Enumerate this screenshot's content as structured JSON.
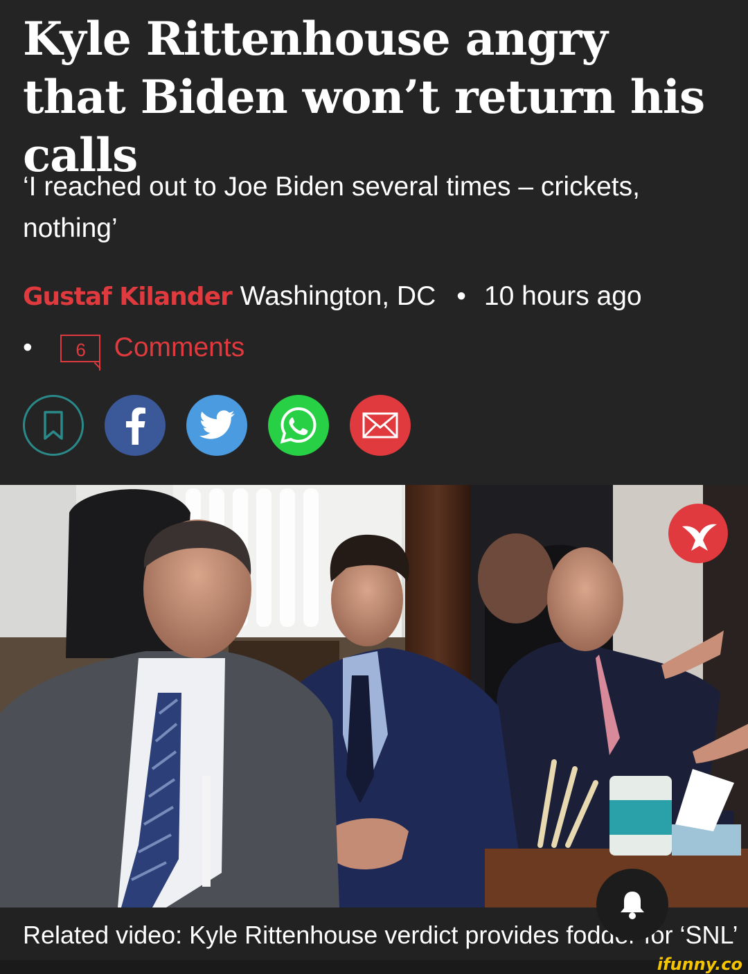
{
  "article": {
    "headline": "Kyle Rittenhouse angry that Biden won’t return his calls",
    "subhead": "‘I reached out to Joe Biden several times – crickets, nothing’",
    "author": "Gustaf Kilander",
    "location": "Washington, DC",
    "separator": "•",
    "time": "10 hours ago",
    "comments_count": "6",
    "comments_label": "Comments"
  },
  "share": [
    {
      "name": "bookmark-icon",
      "color": "#2a8a8a"
    },
    {
      "name": "facebook-icon",
      "color": "#3b5998"
    },
    {
      "name": "twitter-icon",
      "color": "#4b9be0"
    },
    {
      "name": "whatsapp-icon",
      "color": "#27d045"
    },
    {
      "name": "email-icon",
      "color": "#e03a3e"
    }
  ],
  "media": {
    "caption": "Related video: Kyle Rittenhouse verdict provides fodder for ‘SNL’",
    "badge_icon": "eagle-logo-icon",
    "notify_icon": "bell-icon"
  },
  "watermark": "ifunny.co",
  "colors": {
    "background": "#242424",
    "accent": "#e03a3e"
  }
}
